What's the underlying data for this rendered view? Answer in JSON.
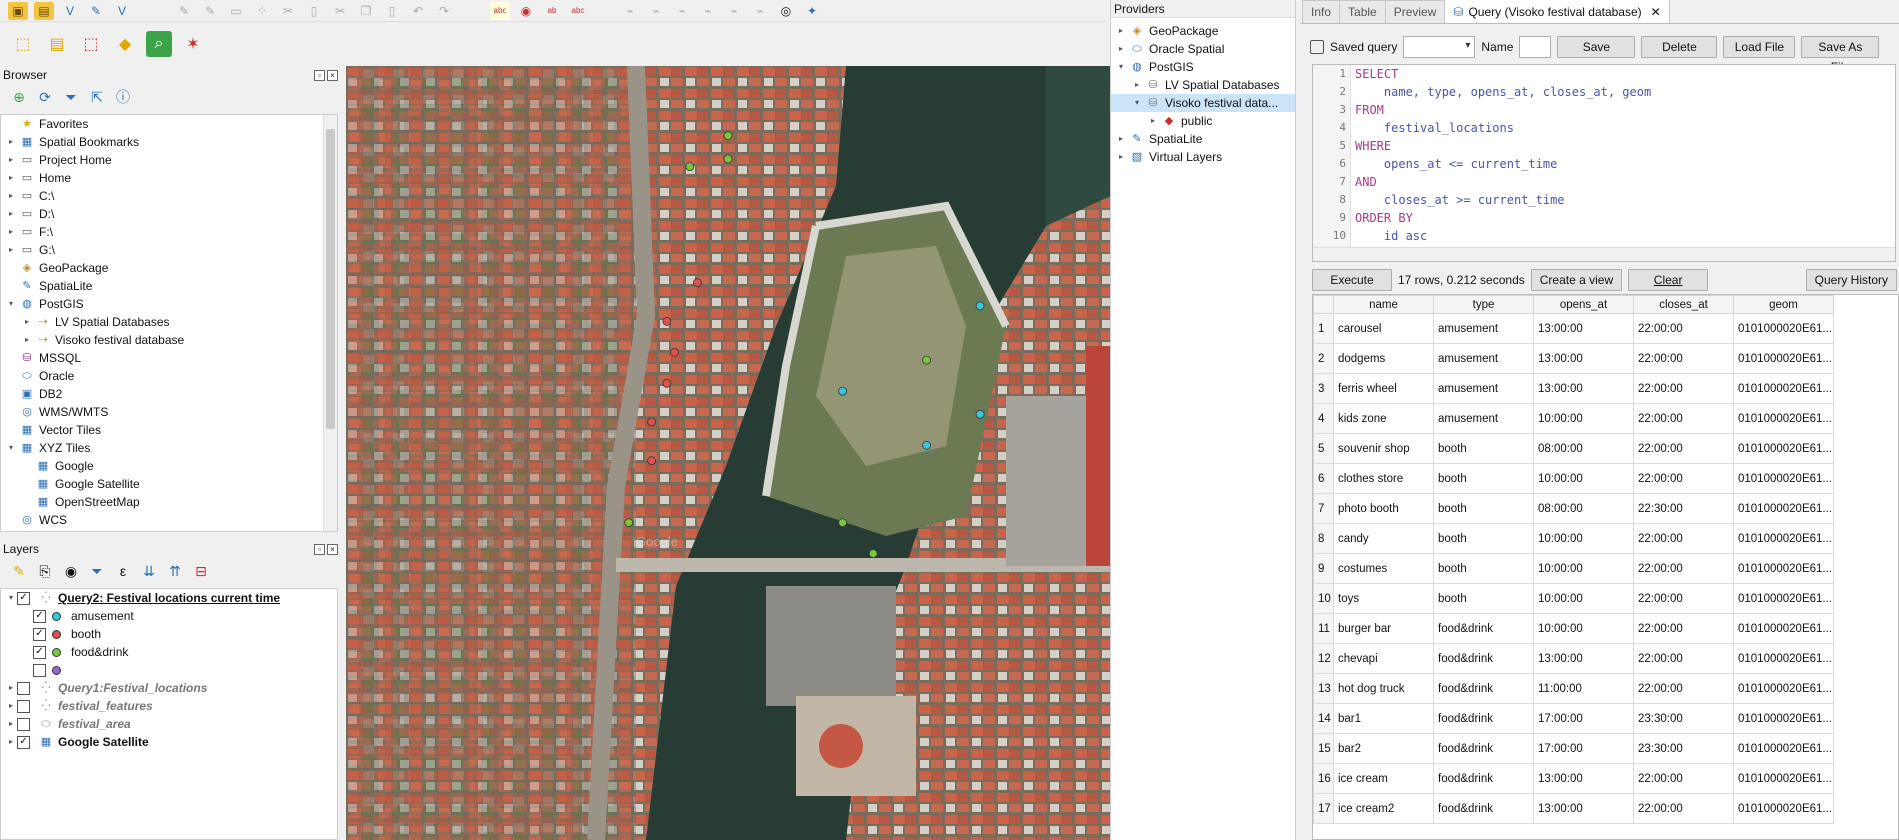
{
  "toolbar_icons": [
    "layer-add-icon",
    "csv-icon",
    "digitize-icon",
    "pencil-icon",
    "save-icon",
    "delete-icon",
    "cut-icon",
    "copy-icon",
    "paste-icon",
    "undo-icon",
    "redo-icon",
    "label-abc-icon",
    "label-pin-icon",
    "label-highlight-icon",
    "label-red-icon",
    "plugin-icon",
    "python-icon"
  ],
  "browser": {
    "title": "Browser",
    "items": [
      {
        "label": "Favorites",
        "icon": "star-icon",
        "depth": 0,
        "arrow": ""
      },
      {
        "label": "Spatial Bookmarks",
        "icon": "bookmark-icon",
        "depth": 0,
        "arrow": "▸"
      },
      {
        "label": "Project Home",
        "icon": "folder-icon",
        "depth": 0,
        "arrow": "▸"
      },
      {
        "label": "Home",
        "icon": "folder-icon",
        "depth": 0,
        "arrow": "▸"
      },
      {
        "label": "C:\\",
        "icon": "folder-icon",
        "depth": 0,
        "arrow": "▸"
      },
      {
        "label": "D:\\",
        "icon": "folder-icon",
        "depth": 0,
        "arrow": "▸"
      },
      {
        "label": "F:\\",
        "icon": "folder-icon",
        "depth": 0,
        "arrow": "▸"
      },
      {
        "label": "G:\\",
        "icon": "folder-icon",
        "depth": 0,
        "arrow": "▸"
      },
      {
        "label": "GeoPackage",
        "icon": "geopackage-icon",
        "depth": 0,
        "arrow": ""
      },
      {
        "label": "SpatiaLite",
        "icon": "spatialite-icon",
        "depth": 0,
        "arrow": ""
      },
      {
        "label": "PostGIS",
        "icon": "postgis-icon",
        "depth": 0,
        "arrow": "▾"
      },
      {
        "label": "LV Spatial Databases",
        "icon": "connection-icon",
        "depth": 1,
        "arrow": "▸"
      },
      {
        "label": "Visoko festival database",
        "icon": "connection-icon",
        "depth": 1,
        "arrow": "▸"
      },
      {
        "label": "MSSQL",
        "icon": "mssql-icon",
        "depth": 0,
        "arrow": ""
      },
      {
        "label": "Oracle",
        "icon": "oracle-icon",
        "depth": 0,
        "arrow": ""
      },
      {
        "label": "DB2",
        "icon": "db2-icon",
        "depth": 0,
        "arrow": ""
      },
      {
        "label": "WMS/WMTS",
        "icon": "globe-icon",
        "depth": 0,
        "arrow": ""
      },
      {
        "label": "Vector Tiles",
        "icon": "grid-icon",
        "depth": 0,
        "arrow": ""
      },
      {
        "label": "XYZ Tiles",
        "icon": "grid-icon",
        "depth": 0,
        "arrow": "▾"
      },
      {
        "label": "Google",
        "icon": "grid-icon",
        "depth": 1,
        "arrow": ""
      },
      {
        "label": "Google Satellite",
        "icon": "grid-icon",
        "depth": 1,
        "arrow": ""
      },
      {
        "label": "OpenStreetMap",
        "icon": "grid-icon",
        "depth": 1,
        "arrow": ""
      },
      {
        "label": "WCS",
        "icon": "globe-icon",
        "depth": 0,
        "arrow": ""
      }
    ]
  },
  "layers": {
    "title": "Layers",
    "items": [
      {
        "label": "Query2: Festival locations current time",
        "checked": true,
        "style": "bold-underline",
        "depth": 0,
        "arrow": "▾",
        "icon": "points"
      },
      {
        "label": "amusement",
        "checked": true,
        "style": "normal",
        "depth": 1,
        "arrow": "",
        "dot": "#33c9e0"
      },
      {
        "label": "booth",
        "checked": true,
        "style": "normal",
        "depth": 1,
        "arrow": "",
        "dot": "#e0504c"
      },
      {
        "label": "food&drink",
        "checked": true,
        "style": "normal",
        "depth": 1,
        "arrow": "",
        "dot": "#78c93a"
      },
      {
        "label": "",
        "checked": false,
        "style": "normal",
        "depth": 1,
        "arrow": "",
        "dot": "#9a63c9"
      },
      {
        "label": "Query1:Festival_locations",
        "checked": false,
        "style": "italic",
        "depth": 0,
        "arrow": "▸",
        "icon": "points"
      },
      {
        "label": "festival_features",
        "checked": false,
        "style": "italic",
        "depth": 0,
        "arrow": "▸",
        "icon": "points"
      },
      {
        "label": "festival_area",
        "checked": false,
        "style": "italic",
        "depth": 0,
        "arrow": "▸",
        "icon": "polygon"
      },
      {
        "label": "Google Satellite",
        "checked": true,
        "style": "bold",
        "depth": 0,
        "arrow": "▸",
        "icon": "raster"
      }
    ]
  },
  "map": {
    "watermark": "Google",
    "points": [
      {
        "cat": "food",
        "x": 0.5,
        "y": 0.09
      },
      {
        "cat": "food",
        "x": 0.45,
        "y": 0.13
      },
      {
        "cat": "food",
        "x": 0.5,
        "y": 0.12
      },
      {
        "cat": "booth",
        "x": 0.46,
        "y": 0.28
      },
      {
        "cat": "booth",
        "x": 0.42,
        "y": 0.33
      },
      {
        "cat": "booth",
        "x": 0.43,
        "y": 0.37
      },
      {
        "cat": "booth",
        "x": 0.42,
        "y": 0.41
      },
      {
        "cat": "booth",
        "x": 0.4,
        "y": 0.46
      },
      {
        "cat": "booth",
        "x": 0.4,
        "y": 0.51
      },
      {
        "cat": "amuse",
        "x": 0.83,
        "y": 0.31
      },
      {
        "cat": "food",
        "x": 0.76,
        "y": 0.38
      },
      {
        "cat": "amuse",
        "x": 0.65,
        "y": 0.42
      },
      {
        "cat": "amuse",
        "x": 0.83,
        "y": 0.45
      },
      {
        "cat": "amuse",
        "x": 0.76,
        "y": 0.49
      },
      {
        "cat": "food",
        "x": 0.37,
        "y": 0.59
      },
      {
        "cat": "food",
        "x": 0.65,
        "y": 0.59
      },
      {
        "cat": "food",
        "x": 0.69,
        "y": 0.63
      }
    ]
  },
  "providers": {
    "title": "Providers",
    "items": [
      {
        "label": "GeoPackage",
        "icon": "geopackage-icon",
        "depth": 0,
        "arrow": "▸"
      },
      {
        "label": "Oracle Spatial",
        "icon": "oracle-icon",
        "depth": 0,
        "arrow": "▸"
      },
      {
        "label": "PostGIS",
        "icon": "postgis-icon",
        "depth": 0,
        "arrow": "▾"
      },
      {
        "label": "LV Spatial Databases",
        "icon": "database-icon",
        "depth": 1,
        "arrow": "▸"
      },
      {
        "label": "Visoko festival data...",
        "icon": "database-icon",
        "depth": 1,
        "arrow": "▾",
        "selected": true
      },
      {
        "label": "public",
        "icon": "schema-icon",
        "depth": 2,
        "arrow": "▸"
      },
      {
        "label": "SpatiaLite",
        "icon": "spatialite-icon",
        "depth": 0,
        "arrow": "▸"
      },
      {
        "label": "Virtual Layers",
        "icon": "virtual-icon",
        "depth": 0,
        "arrow": "▸"
      }
    ]
  },
  "query": {
    "tabs": [
      "Info",
      "Table",
      "Preview"
    ],
    "active_tab": "Query (Visoko festival database)",
    "saved_query_label": "Saved query",
    "name_label": "Name",
    "save": "Save",
    "delete": "Delete",
    "load_file": "Load File",
    "save_as_file": "Save As File",
    "sql_lines": [
      {
        "n": "1",
        "kw": "SELECT",
        "text": ""
      },
      {
        "n": "2",
        "kw": "",
        "text": "    name, type, opens_at, closes_at, geom"
      },
      {
        "n": "3",
        "kw": "FROM",
        "text": ""
      },
      {
        "n": "4",
        "kw": "",
        "text": "    festival_locations"
      },
      {
        "n": "5",
        "kw": "WHERE",
        "text": ""
      },
      {
        "n": "6",
        "kw": "",
        "text": "    opens_at <= current_time"
      },
      {
        "n": "7",
        "kw": "AND",
        "text": ""
      },
      {
        "n": "8",
        "kw": "",
        "text": "    closes_at >= current_time"
      },
      {
        "n": "9",
        "kw": "ORDER BY",
        "text": ""
      },
      {
        "n": "10",
        "kw": "",
        "text": "    id asc"
      }
    ],
    "execute": "Execute",
    "status": "17 rows, 0.212 seconds",
    "create_view": "Create a view",
    "clear": "Clear",
    "query_history": "Query History",
    "columns": [
      "name",
      "type",
      "opens_at",
      "closes_at",
      "geom"
    ],
    "rows": [
      [
        "1",
        "carousel",
        "amusement",
        "13:00:00",
        "22:00:00",
        "0101000020E61..."
      ],
      [
        "2",
        "dodgems",
        "amusement",
        "13:00:00",
        "22:00:00",
        "0101000020E61..."
      ],
      [
        "3",
        "ferris wheel",
        "amusement",
        "13:00:00",
        "22:00:00",
        "0101000020E61..."
      ],
      [
        "4",
        "kids zone",
        "amusement",
        "10:00:00",
        "22:00:00",
        "0101000020E61..."
      ],
      [
        "5",
        "souvenir shop",
        "booth",
        "08:00:00",
        "22:00:00",
        "0101000020E61..."
      ],
      [
        "6",
        "clothes store",
        "booth",
        "10:00:00",
        "22:00:00",
        "0101000020E61..."
      ],
      [
        "7",
        "photo booth",
        "booth",
        "08:00:00",
        "22:30:00",
        "0101000020E61..."
      ],
      [
        "8",
        "candy",
        "booth",
        "10:00:00",
        "22:00:00",
        "0101000020E61..."
      ],
      [
        "9",
        "costumes",
        "booth",
        "10:00:00",
        "22:00:00",
        "0101000020E61..."
      ],
      [
        "10",
        "toys",
        "booth",
        "10:00:00",
        "22:00:00",
        "0101000020E61..."
      ],
      [
        "11",
        "burger bar",
        "food&drink",
        "10:00:00",
        "22:00:00",
        "0101000020E61..."
      ],
      [
        "12",
        "chevapi",
        "food&drink",
        "13:00:00",
        "22:00:00",
        "0101000020E61..."
      ],
      [
        "13",
        "hot dog truck",
        "food&drink",
        "11:00:00",
        "22:00:00",
        "0101000020E61..."
      ],
      [
        "14",
        "bar1",
        "food&drink",
        "17:00:00",
        "23:30:00",
        "0101000020E61..."
      ],
      [
        "15",
        "bar2",
        "food&drink",
        "17:00:00",
        "23:30:00",
        "0101000020E61..."
      ],
      [
        "16",
        "ice cream",
        "food&drink",
        "13:00:00",
        "22:00:00",
        "0101000020E61..."
      ],
      [
        "17",
        "ice cream2",
        "food&drink",
        "13:00:00",
        "22:00:00",
        "0101000020E61..."
      ]
    ]
  },
  "colors": {
    "amusement": "#33c9e0",
    "booth": "#e0504c",
    "food": "#78c93a",
    "accent": "#2a6fb5"
  }
}
